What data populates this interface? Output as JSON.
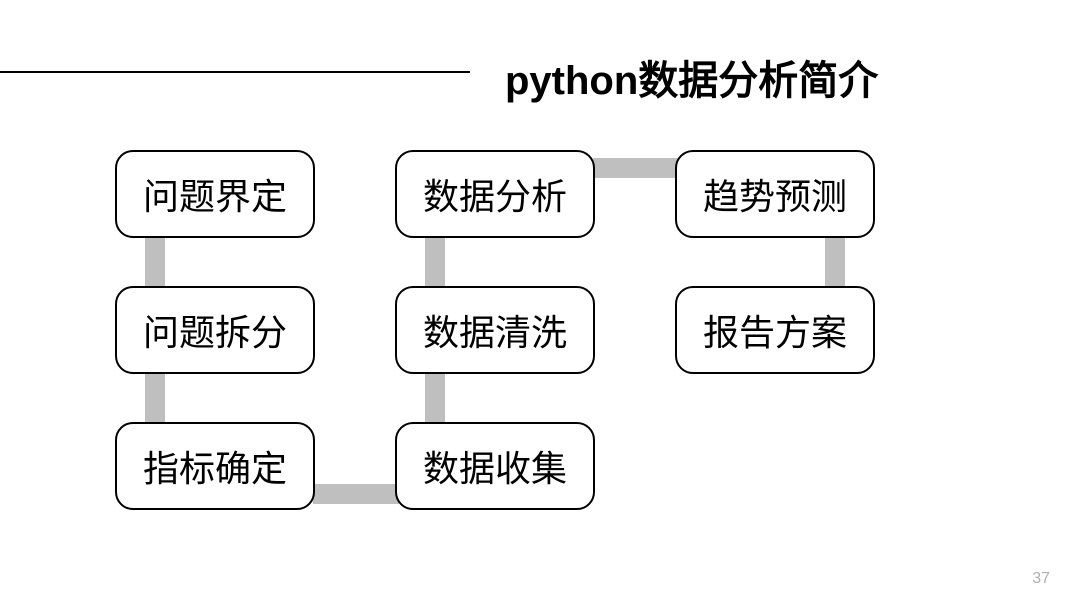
{
  "title": "python数据分析简介",
  "boxes": {
    "b1": "问题界定",
    "b2": "问题拆分",
    "b3": "指标确定",
    "b4": "数据分析",
    "b5": "数据清洗",
    "b6": "数据收集",
    "b7": "趋势预测",
    "b8": "报告方案"
  },
  "pageNumber": "37"
}
